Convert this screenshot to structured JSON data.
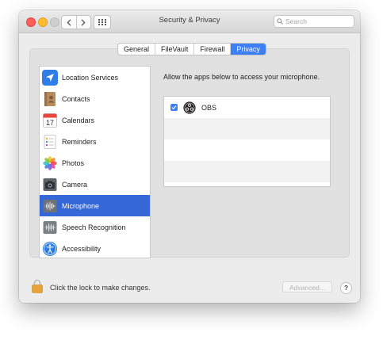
{
  "window": {
    "title": "Security & Privacy",
    "search": {
      "placeholder": "Search",
      "value": ""
    }
  },
  "tabs": [
    {
      "label": "General",
      "active": false
    },
    {
      "label": "FileVault",
      "active": false
    },
    {
      "label": "Firewall",
      "active": false
    },
    {
      "label": "Privacy",
      "active": true
    }
  ],
  "sidebar": {
    "items": [
      {
        "label": "Location Services",
        "icon": "location-arrow-icon",
        "selected": false
      },
      {
        "label": "Contacts",
        "icon": "contacts-book-icon",
        "selected": false
      },
      {
        "label": "Calendars",
        "icon": "calendar-icon",
        "calendar_day": "17",
        "selected": false
      },
      {
        "label": "Reminders",
        "icon": "reminders-list-icon",
        "selected": false
      },
      {
        "label": "Photos",
        "icon": "photos-flower-icon",
        "selected": false
      },
      {
        "label": "Camera",
        "icon": "camera-icon",
        "selected": false
      },
      {
        "label": "Microphone",
        "icon": "microphone-waveform-icon",
        "selected": true
      },
      {
        "label": "Speech Recognition",
        "icon": "speech-waveform-icon",
        "selected": false
      },
      {
        "label": "Accessibility",
        "icon": "accessibility-icon",
        "selected": false
      }
    ]
  },
  "content": {
    "description": "Allow the apps below to access your microphone.",
    "apps": [
      {
        "name": "OBS",
        "checked": true,
        "icon": "obs-icon"
      }
    ]
  },
  "footer": {
    "lock_text": "Click the lock to make changes.",
    "advanced_label": "Advanced...",
    "help_label": "?"
  },
  "colors": {
    "accent": "#3d7ff5",
    "selected_row": "#3567d6"
  }
}
